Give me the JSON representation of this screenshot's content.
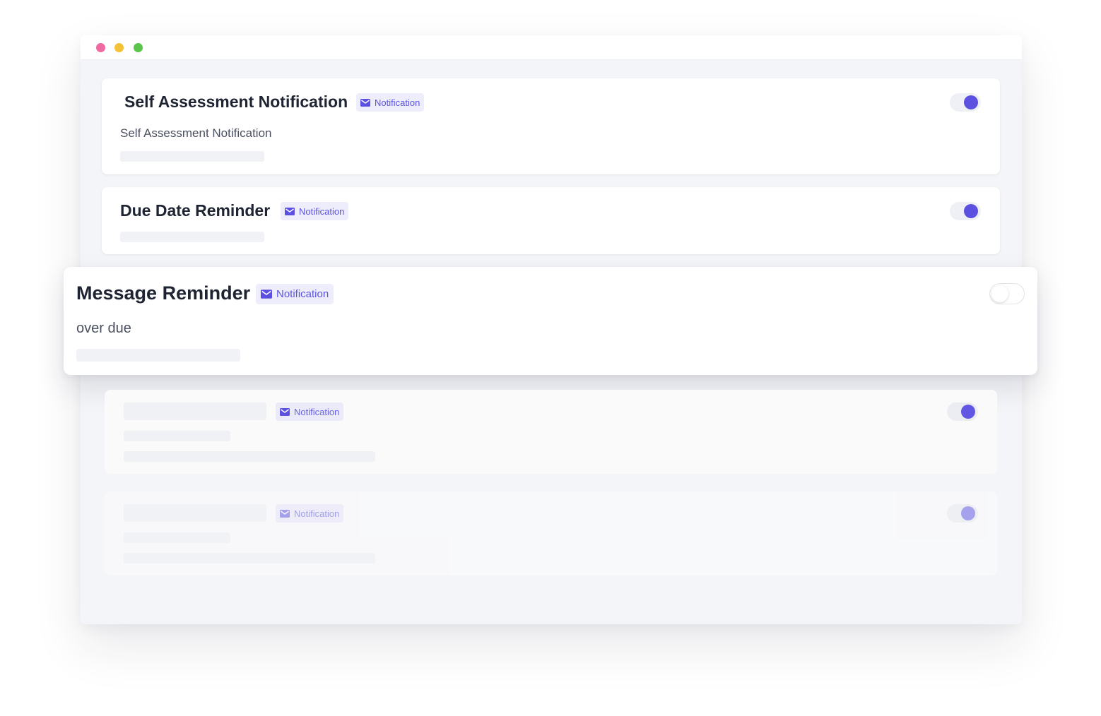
{
  "window": {
    "traffic_lights": {
      "red": "#f06aa2",
      "yellow": "#f4c237",
      "green": "#5bc54b"
    }
  },
  "colors": {
    "accent": "#5b50e0",
    "badge_bg": "#eeedfc",
    "badge_text": "#5b53e0"
  },
  "cards": [
    {
      "title": "Self Assessment Notification",
      "badge": "Notification",
      "badge_icon": "mail-icon",
      "subtitle": "Self Assessment Notification",
      "enabled": true
    },
    {
      "title": "Due Date Reminder",
      "badge": "Notification",
      "badge_icon": "mail-icon",
      "enabled": true
    },
    {
      "title": "Message Reminder",
      "badge": "Notification",
      "badge_icon": "mail-icon",
      "subtitle": "over due",
      "enabled": false
    },
    {
      "badge": "Notification",
      "badge_icon": "mail-icon",
      "enabled": true
    },
    {
      "badge": "Notification",
      "badge_icon": "mail-icon",
      "enabled": true
    }
  ]
}
